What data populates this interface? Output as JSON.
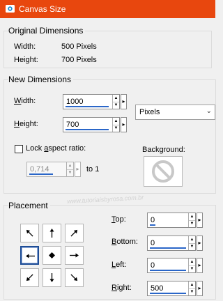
{
  "window": {
    "title": "Canvas Size",
    "icon": "canvas-icon"
  },
  "original": {
    "group_title": "Original Dimensions",
    "width_label": "Width:",
    "width_value": "500 Pixels",
    "height_label": "Height:",
    "height_value": "700 Pixels"
  },
  "new_dims": {
    "group_title": "New Dimensions",
    "width_label_u": "W",
    "width_label_rest": "idth:",
    "width_value": "1000",
    "height_label_u": "H",
    "height_label_rest": "eight:",
    "height_value": "700",
    "units": "Pixels",
    "lock_label_pre": "Lock ",
    "lock_label_u": "a",
    "lock_label_post": "spect ratio:",
    "lock_checked": false,
    "aspect_value": "0,714",
    "to_label": "to 1",
    "background_label": "Background:",
    "background_icon": "no-entry-icon"
  },
  "placement": {
    "group_title": "Placement",
    "anchors": [
      "up-left",
      "up",
      "up-right",
      "left",
      "center",
      "right",
      "down-left",
      "down",
      "down-right"
    ],
    "selected_anchor": "left",
    "top_label_u": "T",
    "top_label_rest": "op:",
    "top_value": "0",
    "bottom_label_u": "B",
    "bottom_label_rest": "ottom:",
    "bottom_value": "0",
    "left_label_u": "L",
    "left_label_rest": "eft:",
    "left_value": "0",
    "right_label_u": "R",
    "right_label_rest": "ight:",
    "right_value": "500"
  },
  "watermark": "www.tutoriaisbyrosa.com.br"
}
